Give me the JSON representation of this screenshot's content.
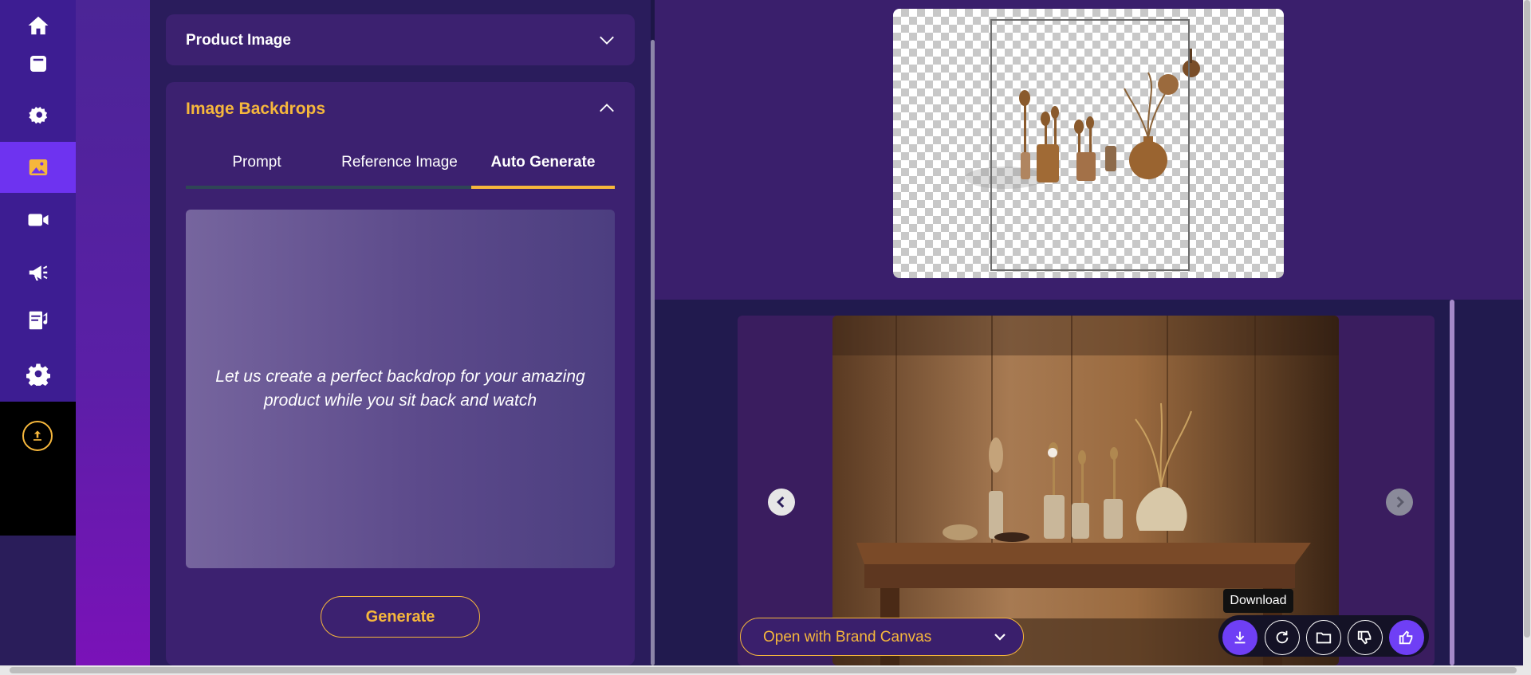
{
  "sidebar": {
    "icons": [
      "home-icon",
      "product-icon",
      "auto-settings-icon",
      "image-icon",
      "video-icon",
      "megaphone-icon",
      "content-icon",
      "settings-icon"
    ],
    "active": "image-icon",
    "upload_icon": "upload-icon"
  },
  "product_section": {
    "title": "Product Image"
  },
  "backdrops_section": {
    "title": "Image Backdrops",
    "tabs": [
      "Prompt",
      "Reference Image",
      "Auto Generate"
    ],
    "active_tab": "Auto Generate",
    "info_text": "Let us create a perfect backdrop for your amazing product while you sit back and watch",
    "generate_label": "Generate"
  },
  "gallery": {
    "brand_canvas_label": "Open with Brand Canvas",
    "tooltip": "Download",
    "actions": [
      "download-icon",
      "refresh-icon",
      "folder-icon",
      "thumbs-down-icon",
      "thumbs-up-icon"
    ]
  },
  "colors": {
    "accent": "#f6b73c",
    "primary": "#6f3ff5",
    "rail": "#3d1d92",
    "panel": "#2a1c5c"
  }
}
